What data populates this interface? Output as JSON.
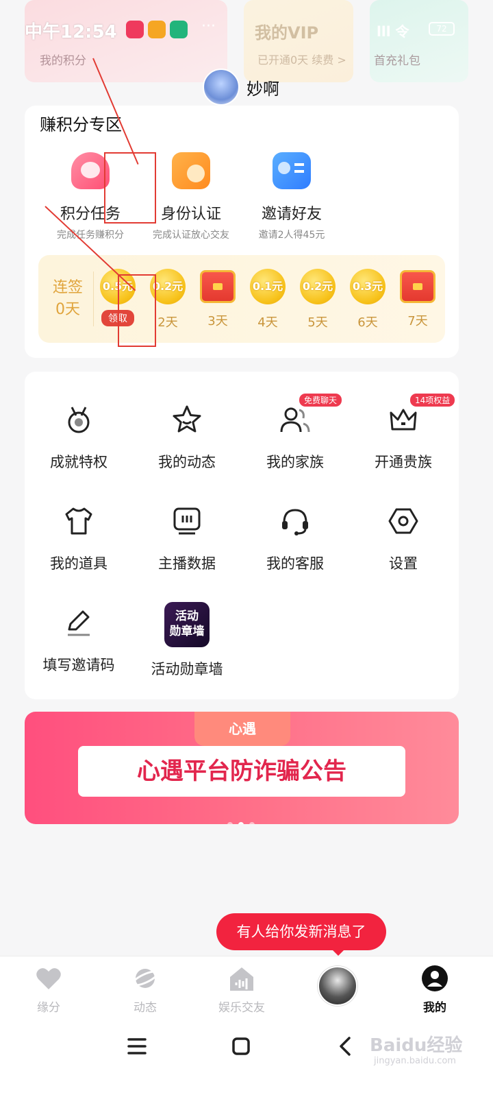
{
  "status_bar": {
    "time": "中午12:54",
    "right_text": "lll 令",
    "battery": "72"
  },
  "top_cards": {
    "left_sub": "我的积分",
    "vip_title": "我的VIP",
    "vip_sub": "已开通0天 续费 >",
    "right_sub": "首充礼包"
  },
  "user": {
    "name": "妙啊"
  },
  "earn": {
    "title": "赚积分专区",
    "items": [
      {
        "label": "积分任务",
        "sub": "完成任务赚积分"
      },
      {
        "label": "身份认证",
        "sub": "完成认证放心交友"
      },
      {
        "label": "邀请好友",
        "sub": "邀请2人得45元"
      }
    ],
    "checkin": {
      "label_line1": "连签",
      "label_line2": "0天",
      "claim_label": "领取",
      "days": [
        {
          "reward": "0.5元",
          "label": "领取",
          "type": "coin"
        },
        {
          "reward": "0.2元",
          "label": "2天",
          "type": "coin"
        },
        {
          "reward": "",
          "label": "3天",
          "type": "chest"
        },
        {
          "reward": "0.1元",
          "label": "4天",
          "type": "coin"
        },
        {
          "reward": "0.2元",
          "label": "5天",
          "type": "coin"
        },
        {
          "reward": "0.3元",
          "label": "6天",
          "type": "coin"
        },
        {
          "reward": "",
          "label": "7天",
          "type": "chest"
        }
      ]
    }
  },
  "menu": {
    "items": [
      {
        "label": "成就特权",
        "icon": "medal-icon",
        "badge": ""
      },
      {
        "label": "我的动态",
        "icon": "star-icon",
        "badge": ""
      },
      {
        "label": "我的家族",
        "icon": "group-icon",
        "badge": "免费聊天"
      },
      {
        "label": "开通贵族",
        "icon": "crown-icon",
        "badge": "14项权益"
      },
      {
        "label": "我的道具",
        "icon": "shirt-icon",
        "badge": ""
      },
      {
        "label": "主播数据",
        "icon": "monitor-icon",
        "badge": ""
      },
      {
        "label": "我的客服",
        "icon": "headset-icon",
        "badge": ""
      },
      {
        "label": "设置",
        "icon": "settings-icon",
        "badge": ""
      },
      {
        "label": "填写邀请码",
        "icon": "pen-icon",
        "badge": ""
      },
      {
        "label": "活动勋章墙",
        "icon": "activity-badge-icon",
        "badge": "",
        "tile_text_1": "活动",
        "tile_text_2": "勋章墙"
      }
    ]
  },
  "banner": {
    "brand": "心遇",
    "text": "心遇平台防诈骗公告"
  },
  "message_bubble": "有人给你发新消息了",
  "bottom_nav": {
    "items": [
      {
        "label": "缘分",
        "icon": "heart-icon",
        "active": false
      },
      {
        "label": "动态",
        "icon": "planet-icon",
        "active": false
      },
      {
        "label": "娱乐交友",
        "icon": "house-sound-icon",
        "active": false
      },
      {
        "label": "",
        "icon": "user-avatar",
        "active": false
      },
      {
        "label": "我的",
        "icon": "profile-icon",
        "active": true
      }
    ]
  },
  "watermark": {
    "main": "Baidu经验",
    "sub": "jingyan.baidu.com"
  },
  "colors": {
    "accent": "#f2233f",
    "gold": "#f7c21b",
    "checkin_text": "#c9953b",
    "annotation": "#e23b33"
  }
}
